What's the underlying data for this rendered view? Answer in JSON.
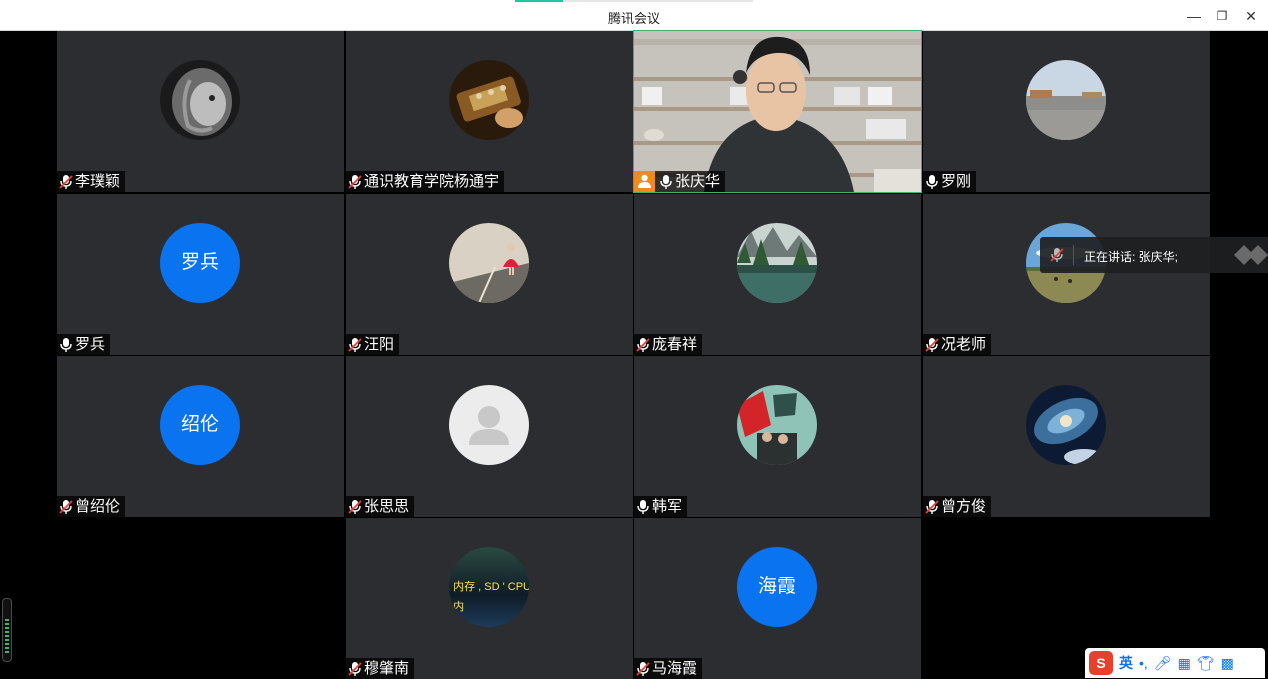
{
  "window": {
    "title": "腾讯会议",
    "minimize": "—",
    "restore": "❐",
    "close": "✕"
  },
  "participants": [
    {
      "name": "李璞颖",
      "avatar": "lion-photo",
      "mic": "muted"
    },
    {
      "name": "通识教育学院杨通宇",
      "avatar": "guitar-photo",
      "mic": "muted"
    },
    {
      "name": "张庆华",
      "avatar": "video",
      "mic": "on",
      "host": true,
      "speaking": true
    },
    {
      "name": "罗刚",
      "avatar": "plaza-photo",
      "mic": "on"
    },
    {
      "name": "罗兵",
      "avatar_text": "罗兵",
      "mic": "on"
    },
    {
      "name": "汪阳",
      "avatar": "girl-road-photo",
      "mic": "muted"
    },
    {
      "name": "庞春祥",
      "avatar": "lake-photo",
      "mic": "muted"
    },
    {
      "name": "况老师",
      "avatar": "grassland-photo",
      "mic": "muted"
    },
    {
      "name": "曾绍伦",
      "avatar_text": "绍伦",
      "mic": "muted"
    },
    {
      "name": "张思思",
      "avatar": "default-person",
      "mic": "muted"
    },
    {
      "name": "韩军",
      "avatar": "poster-photo",
      "mic": "on"
    },
    {
      "name": "曾方俊",
      "avatar": "galaxy-photo",
      "mic": "muted"
    },
    {
      "name": "穆肇南",
      "avatar": "code-screen-photo",
      "avatar_text": ", 内存 , SD ' CPU , 内",
      "mic": "muted"
    },
    {
      "name": "马海霞",
      "avatar_text": "海霞",
      "mic": "muted"
    }
  ],
  "toast": {
    "text": "正在讲话: 张庆华;"
  },
  "ime": {
    "logo": "S",
    "mode": "英"
  },
  "colors": {
    "tile_bg": "#2c2d30",
    "avatar_blue": "#0a73f0",
    "host_orange": "#f08a1c",
    "speaking_green": "#3fb36b"
  }
}
